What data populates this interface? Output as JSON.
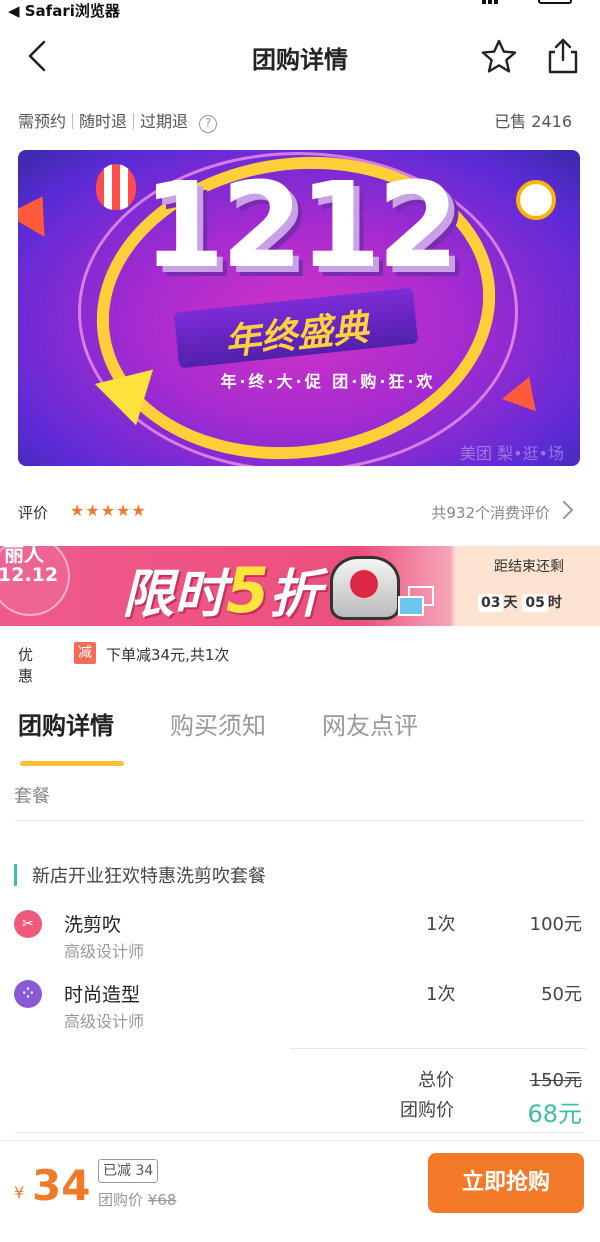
{
  "status_bar": {
    "back_app": "◀ Safari浏览器"
  },
  "nav": {
    "title": "团购详情",
    "back_icon": "chevron-left-icon",
    "star_icon": "star-outline-icon",
    "share_icon": "share-icon"
  },
  "info": {
    "tags": [
      "需预约",
      "随时退",
      "过期退"
    ],
    "help": "?",
    "sold": "已售 2416"
  },
  "banner": {
    "big": "1212",
    "ribbon": "年终盛典",
    "sub": "年·终·大·促  团·购·狂·欢",
    "watermark": "美团 梨•逛•场"
  },
  "rating": {
    "label": "评价",
    "stars": "★★★★★",
    "count": "共932个消费评价"
  },
  "promo": {
    "brand_line1": "丽人",
    "brand_line2": "12.12",
    "flash_a": "限时",
    "flash_five": "5",
    "flash_b": "折",
    "ends_label": "距结束还剩",
    "days": "03",
    "days_unit": "天",
    "hours": "05",
    "hours_unit": "时"
  },
  "discount": {
    "label": "优惠",
    "tag": "减",
    "text": "下单减34元,共1次"
  },
  "tabs": [
    {
      "label": "团购详情",
      "active": true
    },
    {
      "label": "购买须知",
      "active": false
    },
    {
      "label": "网友点评",
      "active": false
    }
  ],
  "section": {
    "label": "套餐"
  },
  "package": {
    "title": "新店开业狂欢特惠洗剪吹套餐",
    "items": [
      {
        "name": "洗剪吹",
        "desc": "高级设计师",
        "qty": "1次",
        "price": "100元",
        "icon": "scissors-icon",
        "color": "#ef5a7a"
      },
      {
        "name": "时尚造型",
        "desc": "高级设计师",
        "qty": "1次",
        "price": "50元",
        "icon": "grid-dots-icon",
        "color": "#8a5ad6"
      }
    ]
  },
  "totals": {
    "total_label": "总价",
    "total_value": "150元",
    "group_label": "团购价",
    "group_value": "68元"
  },
  "footer": {
    "currency": "¥",
    "price": "34",
    "reduced": "已减 34",
    "orig_label": "团购价",
    "orig_currency": "¥",
    "orig_value": "68",
    "buy": "立即抢购"
  },
  "colors": {
    "accent": "#f47a2a",
    "green": "#3ebfa4",
    "tab_underline": "#ffc130"
  }
}
